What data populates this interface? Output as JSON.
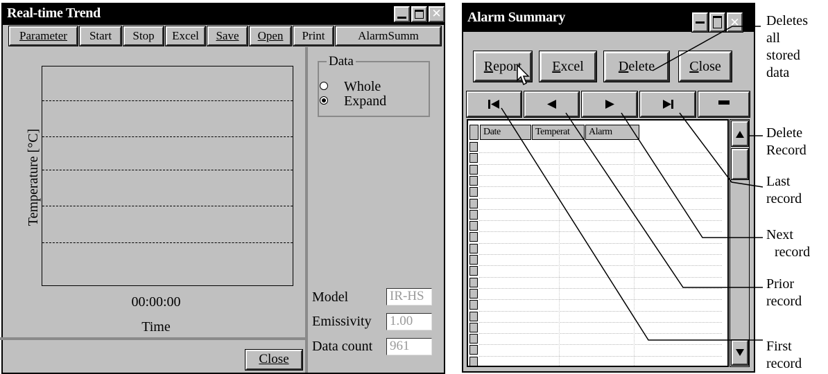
{
  "trend_window": {
    "title": "Real-time Trend",
    "toolbar": [
      "Parameter",
      "Start",
      "Stop",
      "Excel",
      "Save",
      "Open",
      "Print",
      "AlarmSumm"
    ],
    "chart": {
      "ylabel": "Temperature [°C]",
      "time_value": "00:00:00",
      "xlabel": "Time"
    },
    "data_group": {
      "label": "Data",
      "options": [
        {
          "label": "Whole",
          "selected": false
        },
        {
          "label": "Expand",
          "selected": true
        }
      ]
    },
    "fields": {
      "model_label": "Model",
      "model_value": "IR-HS",
      "emissivity_label": "Emissivity",
      "emissivity_value": "1.00",
      "data_count_label": "Data count",
      "data_count_value": "961"
    },
    "close_label": "Close"
  },
  "alarm_window": {
    "title": "Alarm Summary",
    "buttons": {
      "report": {
        "first": "R",
        "rest": "eport"
      },
      "excel": {
        "first": "E",
        "rest": "xcel"
      },
      "delete": {
        "first": "D",
        "rest": "elete"
      },
      "close": {
        "first": "C",
        "rest": "lose"
      }
    },
    "nav_icons": [
      "first-record-icon",
      "prior-record-icon",
      "next-record-icon",
      "last-record-icon",
      "delete-record-icon"
    ],
    "columns": [
      "Date",
      "Temperat",
      "Alarm"
    ]
  },
  "annotations": {
    "deletes_all": [
      "Deletes",
      "all",
      "stored",
      "data"
    ],
    "delete_record": [
      "Delete",
      "Record"
    ],
    "last_record": [
      "Last",
      "record"
    ],
    "next_record": [
      "Next",
      "record"
    ],
    "prior_record": [
      "Prior",
      "record"
    ],
    "first_record": [
      "First",
      "record"
    ]
  }
}
